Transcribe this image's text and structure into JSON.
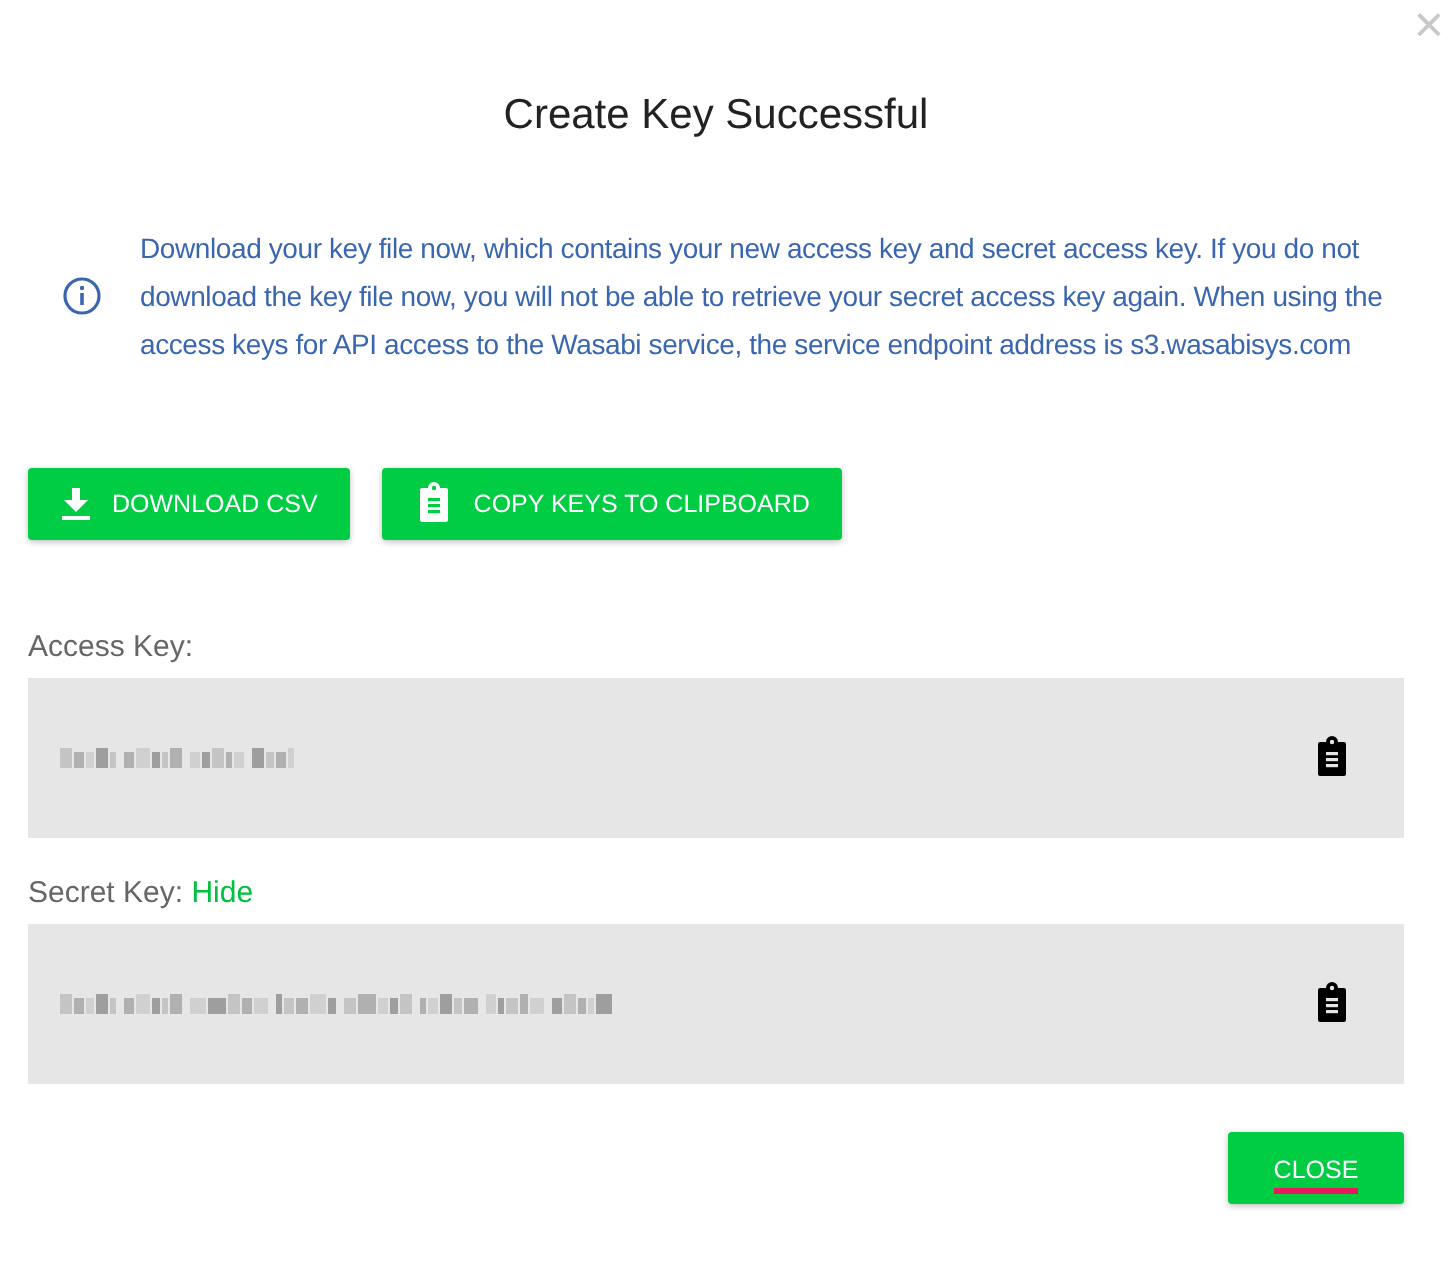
{
  "dialog": {
    "title": "Create Key Successful",
    "close_glyph": "×"
  },
  "notice": "Download your key file now, which contains your new access key and secret access key. If you do not download the key file now, you will not be able to retrieve your secret access key again. When using the access keys for API access to the Wasabi service, the service endpoint address is s3.wasabisys.com",
  "actions": [
    {
      "label": "DOWNLOAD CSV",
      "kind": "download"
    },
    {
      "label": "COPY KEYS TO CLIPBOARD",
      "kind": "clipboard"
    }
  ],
  "keys": [
    {
      "label": "Access Key:",
      "kind": "access"
    },
    {
      "label": "Secret Key:",
      "toggle": "Hide",
      "kind": "secret"
    }
  ],
  "footer_button": {
    "label": "CLOSE",
    "focused": true
  }
}
